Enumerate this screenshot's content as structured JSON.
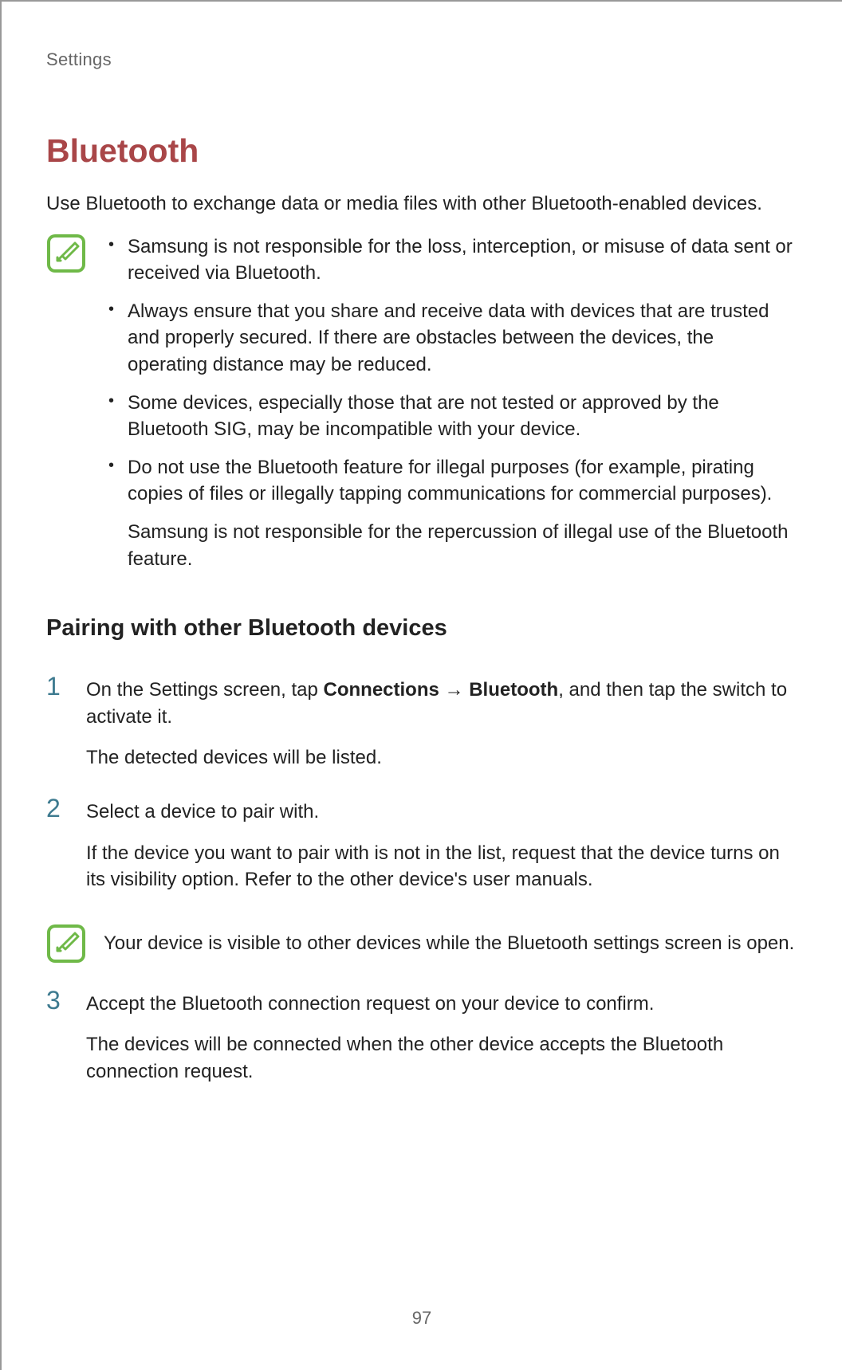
{
  "breadcrumb": "Settings",
  "title": "Bluetooth",
  "intro": "Use Bluetooth to exchange data or media files with other Bluetooth-enabled devices.",
  "notes": {
    "bullets": [
      "Samsung is not responsible for the loss, interception, or misuse of data sent or received via Bluetooth.",
      "Always ensure that you share and receive data with devices that are trusted and properly secured. If there are obstacles between the devices, the operating distance may be reduced.",
      "Some devices, especially those that are not tested or approved by the Bluetooth SIG, may be incompatible with your device.",
      "Do not use the Bluetooth feature for illegal purposes (for example, pirating copies of files or illegally tapping communications for commercial purposes)."
    ],
    "continuation": "Samsung is not responsible for the repercussion of illegal use of the Bluetooth feature."
  },
  "subHeading": "Pairing with other Bluetooth devices",
  "steps": [
    {
      "number": "1",
      "main_prefix": "On the Settings screen, tap ",
      "main_bold1": "Connections",
      "main_arrow": " → ",
      "main_bold2": "Bluetooth",
      "main_suffix": ", and then tap the switch to activate it.",
      "secondary": "The detected devices will be listed."
    },
    {
      "number": "2",
      "main": "Select a device to pair with.",
      "secondary": "If the device you want to pair with is not in the list, request that the device turns on its visibility option. Refer to the other device's user manuals."
    },
    {
      "number": "3",
      "main": "Accept the Bluetooth connection request on your device to confirm.",
      "secondary": "The devices will be connected when the other device accepts the Bluetooth connection request."
    }
  ],
  "inlineNote": "Your device is visible to other devices while the Bluetooth settings screen is open.",
  "pageNumber": "97"
}
